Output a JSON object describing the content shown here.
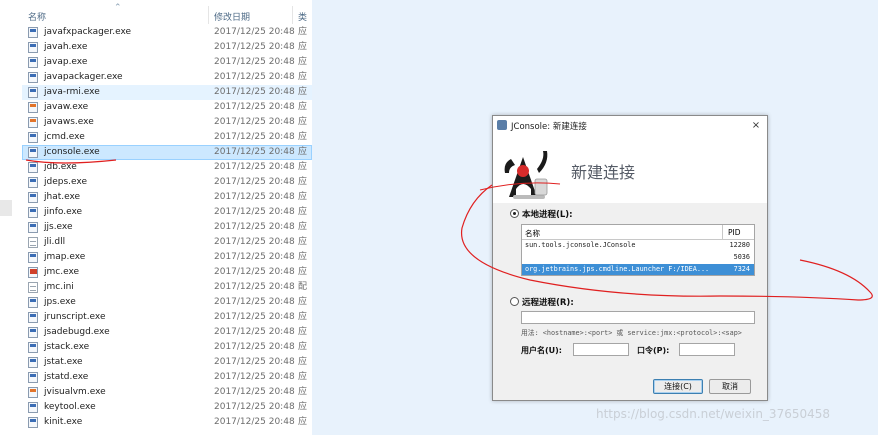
{
  "explorer": {
    "columns": {
      "name": "名称",
      "date": "修改日期",
      "type": "类"
    },
    "files": [
      {
        "name": "javafxpackager.exe",
        "date": "2017/12/25 20:48",
        "type": "应",
        "icon": "exe-icon"
      },
      {
        "name": "javah.exe",
        "date": "2017/12/25 20:48",
        "type": "应",
        "icon": "exe-icon"
      },
      {
        "name": "javap.exe",
        "date": "2017/12/25 20:48",
        "type": "应",
        "icon": "exe-icon"
      },
      {
        "name": "javapackager.exe",
        "date": "2017/12/25 20:48",
        "type": "应",
        "icon": "exe-icon"
      },
      {
        "name": "java-rmi.exe",
        "date": "2017/12/25 20:48",
        "type": "应",
        "icon": "exe-icon"
      },
      {
        "name": "javaw.exe",
        "date": "2017/12/25 20:48",
        "type": "应",
        "icon": "java-icon"
      },
      {
        "name": "javaws.exe",
        "date": "2017/12/25 20:48",
        "type": "应",
        "icon": "java-icon"
      },
      {
        "name": "jcmd.exe",
        "date": "2017/12/25 20:48",
        "type": "应",
        "icon": "exe-icon"
      },
      {
        "name": "jconsole.exe",
        "date": "2017/12/25 20:48",
        "type": "应",
        "icon": "exe-icon"
      },
      {
        "name": "jdb.exe",
        "date": "2017/12/25 20:48",
        "type": "应",
        "icon": "exe-icon"
      },
      {
        "name": "jdeps.exe",
        "date": "2017/12/25 20:48",
        "type": "应",
        "icon": "exe-icon"
      },
      {
        "name": "jhat.exe",
        "date": "2017/12/25 20:48",
        "type": "应",
        "icon": "exe-icon"
      },
      {
        "name": "jinfo.exe",
        "date": "2017/12/25 20:48",
        "type": "应",
        "icon": "exe-icon"
      },
      {
        "name": "jjs.exe",
        "date": "2017/12/25 20:48",
        "type": "应",
        "icon": "exe-icon"
      },
      {
        "name": "jli.dll",
        "date": "2017/12/25 20:48",
        "type": "应",
        "icon": "file-icon"
      },
      {
        "name": "jmap.exe",
        "date": "2017/12/25 20:48",
        "type": "应",
        "icon": "exe-icon"
      },
      {
        "name": "jmc.exe",
        "date": "2017/12/25 20:48",
        "type": "应",
        "icon": "jmc-icon"
      },
      {
        "name": "jmc.ini",
        "date": "2017/12/25 20:48",
        "type": "配",
        "icon": "file-icon"
      },
      {
        "name": "jps.exe",
        "date": "2017/12/25 20:48",
        "type": "应",
        "icon": "exe-icon"
      },
      {
        "name": "jrunscript.exe",
        "date": "2017/12/25 20:48",
        "type": "应",
        "icon": "exe-icon"
      },
      {
        "name": "jsadebugd.exe",
        "date": "2017/12/25 20:48",
        "type": "应",
        "icon": "exe-icon"
      },
      {
        "name": "jstack.exe",
        "date": "2017/12/25 20:48",
        "type": "应",
        "icon": "exe-icon"
      },
      {
        "name": "jstat.exe",
        "date": "2017/12/25 20:48",
        "type": "应",
        "icon": "exe-icon"
      },
      {
        "name": "jstatd.exe",
        "date": "2017/12/25 20:48",
        "type": "应",
        "icon": "exe-icon"
      },
      {
        "name": "jvisualvm.exe",
        "date": "2017/12/25 20:48",
        "type": "应",
        "icon": "java-icon"
      },
      {
        "name": "keytool.exe",
        "date": "2017/12/25 20:48",
        "type": "应",
        "icon": "exe-icon"
      },
      {
        "name": "kinit.exe",
        "date": "2017/12/25 20:48",
        "type": "应",
        "icon": "exe-icon"
      }
    ],
    "hover_index": 4,
    "selected_index": 8
  },
  "dialog": {
    "title": "JConsole: 新建连接",
    "close_label": "×",
    "banner_title": "新建连接",
    "local_label": "本地进程(L):",
    "table_headers": {
      "name": "名称",
      "pid": "PID"
    },
    "processes": [
      {
        "name": "sun.tools.jconsole.JConsole",
        "pid": "12280"
      },
      {
        "name": "",
        "pid": "5036"
      },
      {
        "name": "org.jetbrains.jps.cmdline.Launcher F:/IDEA...",
        "pid": "7324"
      }
    ],
    "selected_process_index": 2,
    "remote_label": "远程进程(R):",
    "remote_value": "",
    "usage_text": "用法: <hostname>:<port> 或 service:jmx:<protocol>:<sap>",
    "username_label": "用户名(U):",
    "password_label": "口令(P):",
    "username_value": "",
    "password_value": "",
    "connect_label": "连接(C)",
    "cancel_label": "取消"
  },
  "watermark": "https://blog.csdn.net/weixin_37650458",
  "colors": {
    "selection": "#cce8ff",
    "dialog_selection": "#3d8fd6",
    "annotation": "#e02020"
  }
}
